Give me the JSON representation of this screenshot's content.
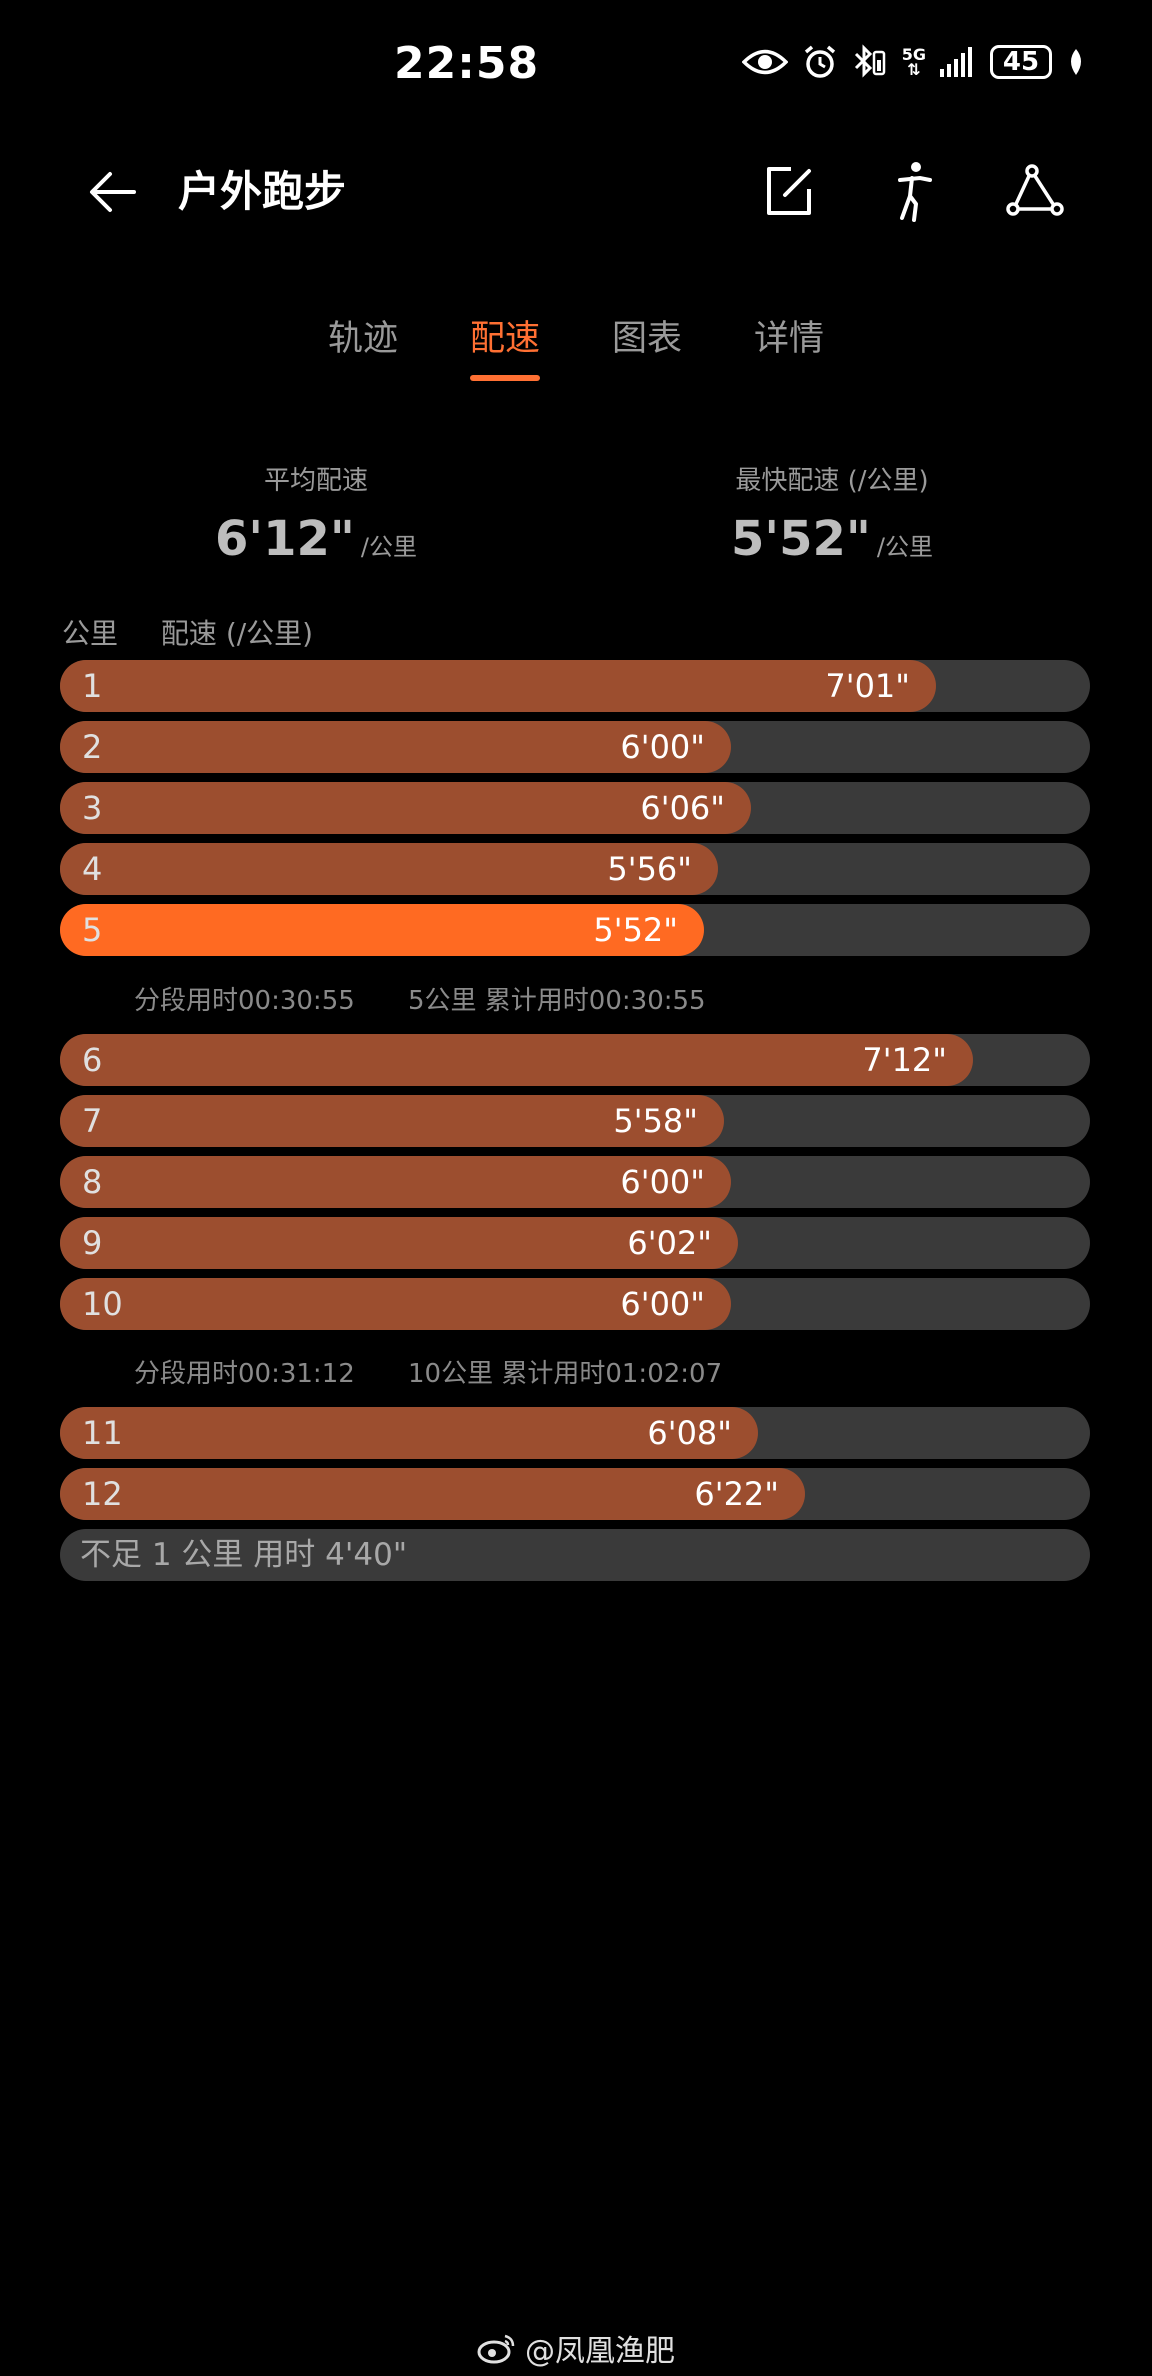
{
  "status": {
    "time": "22:58",
    "network": "5G",
    "battery": "45"
  },
  "header": {
    "title": "户外跑步",
    "icons": [
      "back-arrow-icon",
      "edit-icon",
      "runner-icon",
      "share-route-icon"
    ]
  },
  "tabs": [
    {
      "label": "轨迹",
      "active": false
    },
    {
      "label": "配速",
      "active": true
    },
    {
      "label": "图表",
      "active": false
    },
    {
      "label": "详情",
      "active": false
    }
  ],
  "summary": {
    "avg": {
      "label": "平均配速",
      "value": "6'12\"",
      "unit": "/公里"
    },
    "fastest": {
      "label": "最快配速 (/公里)",
      "value": "5'52\"",
      "unit": "/公里"
    }
  },
  "columns": {
    "km": "公里",
    "pace": "配速 (/公里)"
  },
  "splits": [
    {
      "km": "1",
      "pace": "7'01\"",
      "seconds": 421
    },
    {
      "km": "2",
      "pace": "6'00\"",
      "seconds": 360
    },
    {
      "km": "3",
      "pace": "6'06\"",
      "seconds": 366
    },
    {
      "km": "4",
      "pace": "5'56\"",
      "seconds": 356
    },
    {
      "km": "5",
      "pace": "5'52\"",
      "seconds": 352,
      "highlight": true
    },
    {
      "km": "6",
      "pace": "7'12\"",
      "seconds": 432
    },
    {
      "km": "7",
      "pace": "5'58\"",
      "seconds": 358
    },
    {
      "km": "8",
      "pace": "6'00\"",
      "seconds": 360
    },
    {
      "km": "9",
      "pace": "6'02\"",
      "seconds": 362
    },
    {
      "km": "10",
      "pace": "6'00\"",
      "seconds": 360
    },
    {
      "km": "11",
      "pace": "6'08\"",
      "seconds": 368
    },
    {
      "km": "12",
      "pace": "6'22\"",
      "seconds": 382
    }
  ],
  "segments": [
    {
      "split": "分段用时00:30:55",
      "cumulative": "5公里 累计用时00:30:55"
    },
    {
      "split": "分段用时00:31:12",
      "cumulative": "10公里 累计用时01:02:07"
    }
  ],
  "partial": "不足 1 公里 用时 4'40\"",
  "colors": {
    "accent": "#ff7033",
    "bar": "#9c4e2f",
    "bar_highlight": "#ff6a22",
    "track": "#3a3a3a"
  },
  "watermark": "@凤凰渔肥"
}
